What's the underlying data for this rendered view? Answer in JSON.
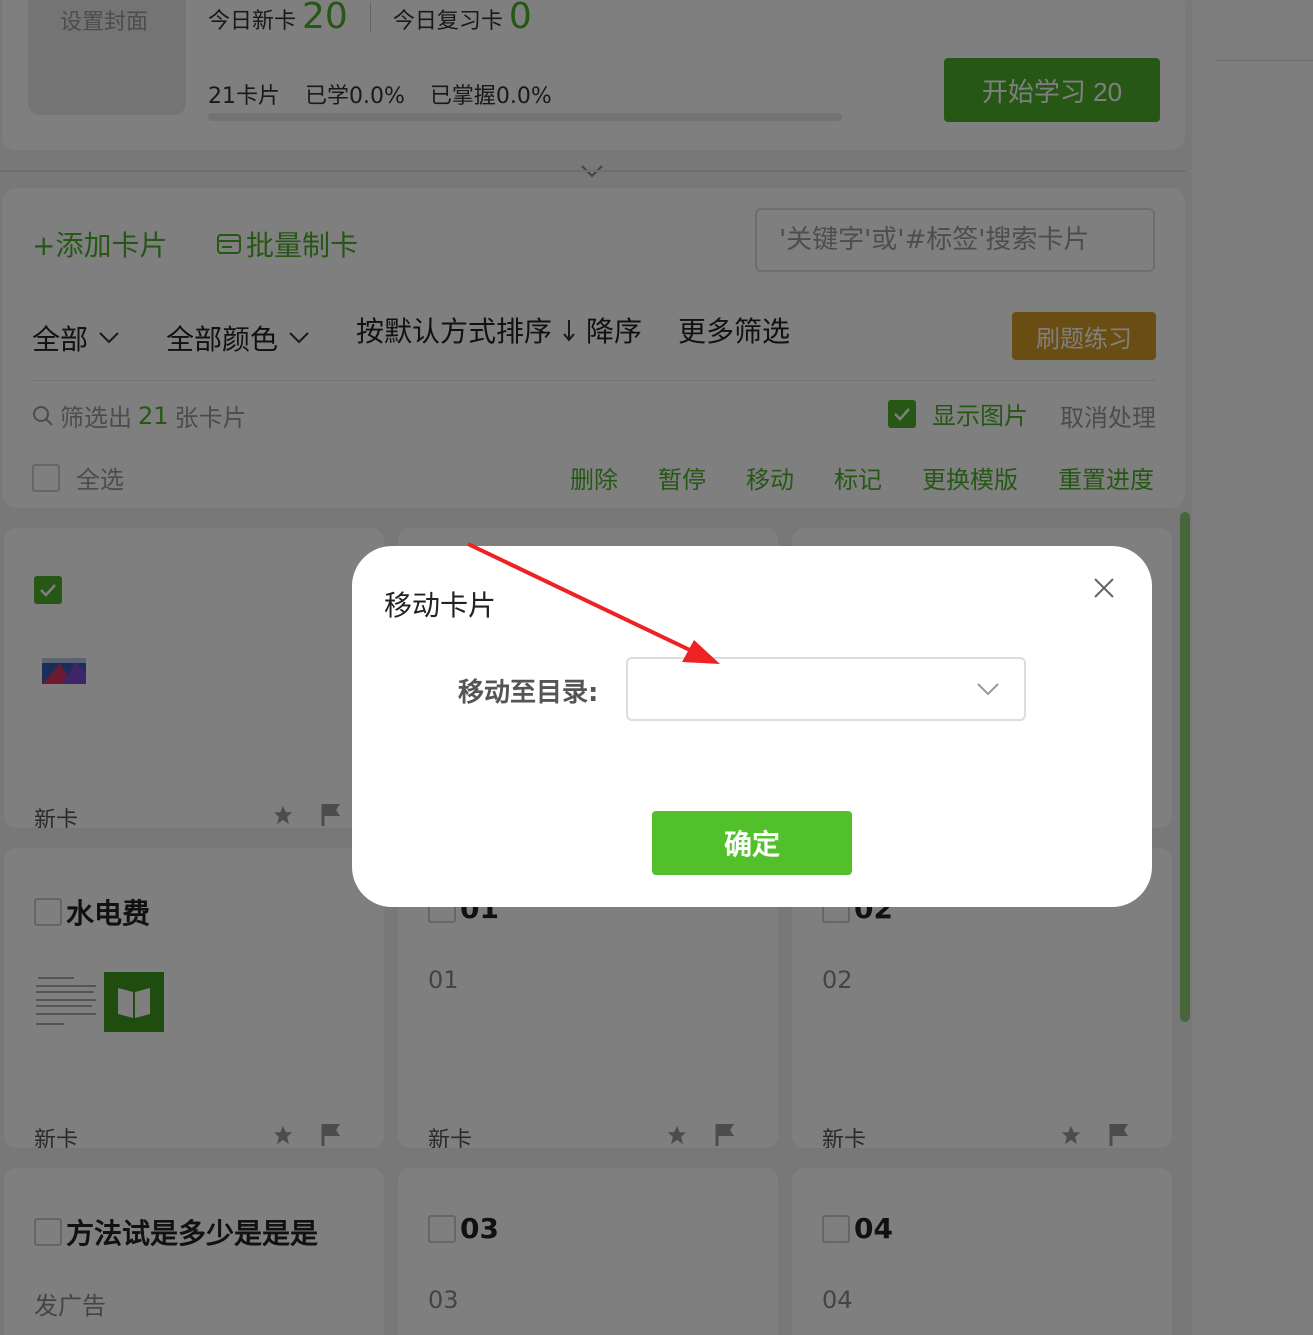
{
  "deck": {
    "cover_label": "设置封面",
    "today_new_label": "今日新卡",
    "today_new_count": "20",
    "today_review_label": "今日复习卡",
    "today_review_count": "0",
    "cards_total": "21卡片",
    "learned": "已学0.0%",
    "mastered": "已掌握0.0%",
    "progress_fraction": 0.0,
    "start_button": "开始学习 20"
  },
  "toolbar": {
    "add_card": "+添加卡片",
    "batch_card": "批量制卡",
    "search_placeholder": "'关键字'或'#标签'搜索卡片",
    "filter_all": "全部",
    "filter_color": "全部颜色",
    "sort": "按默认方式排序",
    "sort_order": "降序",
    "more_filters": "更多筛选",
    "practice_button": "刷题练习",
    "filtered_prefix": "筛选出",
    "filtered_count": "21",
    "filtered_suffix": "张卡片",
    "show_images": "显示图片",
    "cancel_process": "取消处理",
    "select_all": "全选",
    "actions": [
      "删除",
      "暂停",
      "移动",
      "标记",
      "更换模版",
      "重置进度"
    ]
  },
  "cards": [
    {
      "title": "",
      "body": "",
      "status": "新卡",
      "checked": true
    },
    {
      "title": "",
      "body": "",
      "status": "",
      "checked": false
    },
    {
      "title": "",
      "body": "",
      "status": "",
      "checked": false
    },
    {
      "title": "水电费",
      "body": "",
      "status": "新卡",
      "checked": false
    },
    {
      "title": "01",
      "body": "01",
      "status": "新卡",
      "checked": false
    },
    {
      "title": "02",
      "body": "02",
      "status": "新卡",
      "checked": false
    },
    {
      "title": "方法试是多少是是是",
      "body": "发广告",
      "status": "",
      "checked": false
    },
    {
      "title": "03",
      "body": "03",
      "status": "",
      "checked": false
    },
    {
      "title": "04",
      "body": "04",
      "status": "",
      "checked": false
    }
  ],
  "modal": {
    "title": "移动卡片",
    "label": "移动至目录:",
    "select_value": "",
    "confirm": "确定"
  },
  "colors": {
    "accent": "#4caf2a",
    "practice": "#d39a26",
    "arrow": "#ee2222"
  }
}
